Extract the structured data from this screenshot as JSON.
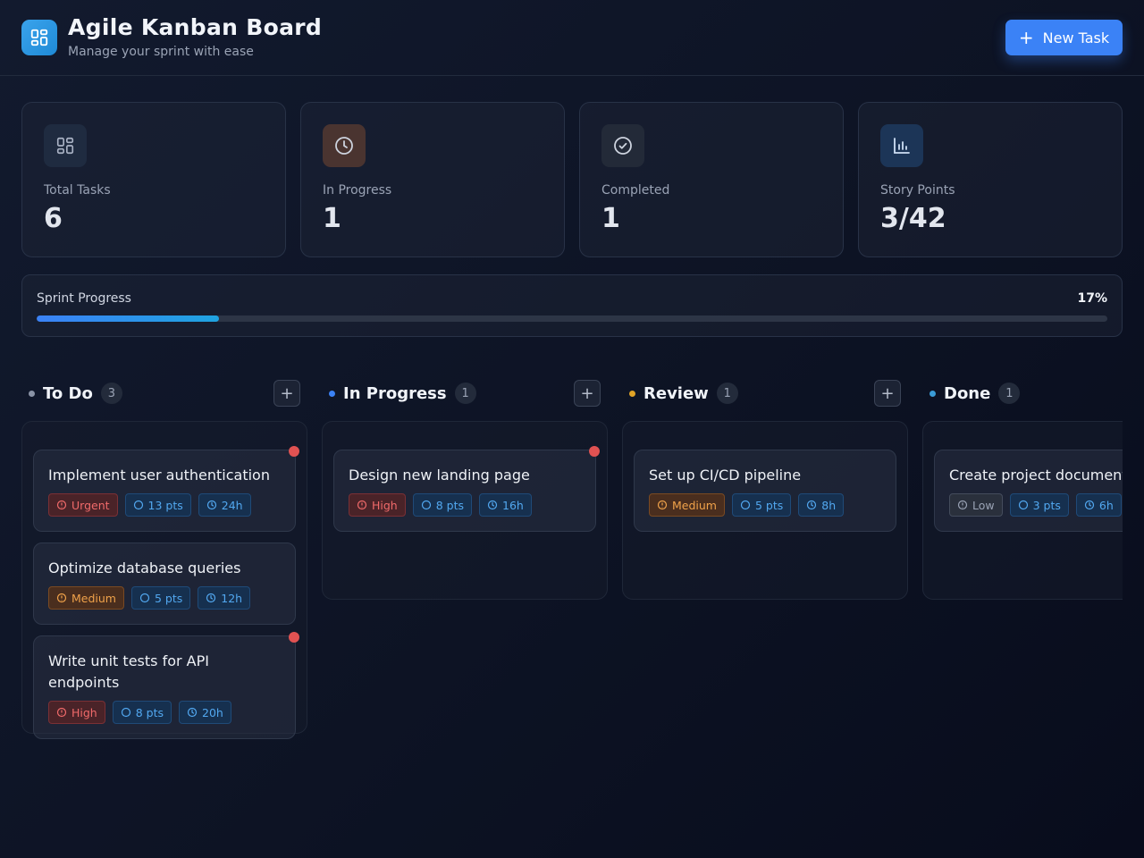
{
  "header": {
    "title": "Agile Kanban Board",
    "subtitle": "Manage your sprint with ease",
    "new_task_label": "New Task"
  },
  "stats": [
    {
      "label": "Total Tasks",
      "value": "6",
      "icon": "grid-icon"
    },
    {
      "label": "In Progress",
      "value": "1",
      "icon": "clock-icon"
    },
    {
      "label": "Completed",
      "value": "1",
      "icon": "check-circle-icon"
    },
    {
      "label": "Story Points",
      "value": "3/42",
      "icon": "bar-chart-icon"
    }
  ],
  "sprint": {
    "label": "Sprint Progress",
    "percent_label": "17%",
    "progress": 0.17
  },
  "columns": [
    {
      "title": "To Do",
      "count": "3",
      "dot_color": "#8a93a6",
      "tasks": [
        {
          "title": "Implement user authentication",
          "priority": "Urgent",
          "points": "13 pts",
          "hours": "24h",
          "flagged": true
        },
        {
          "title": "Optimize database queries",
          "priority": "Medium",
          "points": "5 pts",
          "hours": "12h",
          "flagged": false
        },
        {
          "title": "Write unit tests for API endpoints",
          "priority": "High",
          "points": "8 pts",
          "hours": "20h",
          "flagged": true
        }
      ]
    },
    {
      "title": "In Progress",
      "count": "1",
      "dot_color": "#3b82f6",
      "tasks": [
        {
          "title": "Design new landing page",
          "priority": "High",
          "points": "8 pts",
          "hours": "16h",
          "flagged": true
        }
      ]
    },
    {
      "title": "Review",
      "count": "1",
      "dot_color": "#e0a326",
      "tasks": [
        {
          "title": "Set up CI/CD pipeline",
          "priority": "Medium",
          "points": "5 pts",
          "hours": "8h",
          "flagged": false
        }
      ]
    },
    {
      "title": "Done",
      "count": "1",
      "dot_color": "#3a9bd6",
      "tasks": [
        {
          "title": "Create project documentation",
          "priority": "Low",
          "points": "3 pts",
          "hours": "6h",
          "flagged": false
        }
      ]
    }
  ],
  "colors": {
    "accent": "#3b82f6",
    "urgent": "#e05252",
    "high": "#e05252",
    "medium": "#e08a2a",
    "low": "#8a93a6",
    "info": "#38a3e8"
  }
}
